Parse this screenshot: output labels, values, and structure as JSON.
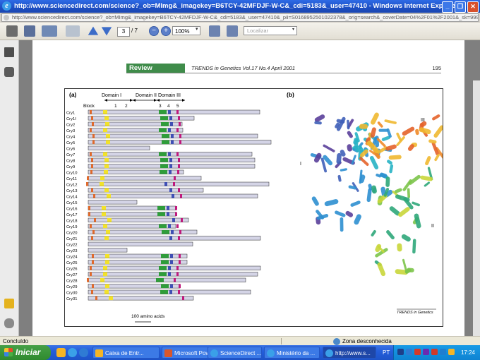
{
  "window": {
    "title": "http://www.sciencedirect.com/science?_ob=MImg&_imagekey=B6TCY-42MFDJF-W-C&_cdi=5183&_user=47410 - Windows Internet Explorer",
    "url": "http://www.sciencedirect.com/science?_ob=MImg&_imagekey=B6TCY-42MFDJF-W-C&_cdi=5183&_user=47410&_pii=S0168952501022378&_orig=search&_coverDate=04%2F01%2F2001&_sk=999829"
  },
  "toolbar": {
    "page_current": "3",
    "page_total": "/ 7",
    "zoom": "100%",
    "search_placeholder": "Localizar"
  },
  "document": {
    "header_tag": "Review",
    "journal": "TRENDS in Genetics  Vol.17 No.4  April 2001",
    "page_number": "195",
    "figure": {
      "panel_a": "(a)",
      "panel_b": "(b)",
      "domain_1": "Domain I",
      "domain_2": "Domain II",
      "domain_3": "Domain III",
      "block_label": "Block",
      "block_numbers": [
        "1",
        "2",
        "3",
        "4",
        "5"
      ],
      "scale_label": "100 amino acids",
      "proteins": [
        "Cry1",
        "Cry1I",
        "Cry2",
        "Cry3",
        "Cry4",
        "Cry5",
        "Cry6",
        "Cry7",
        "Cry8",
        "Cry9",
        "Cry10",
        "Cry11",
        "Cry12",
        "Cry13",
        "Cry14",
        "Cry15",
        "Cry16",
        "Cry17",
        "Cry18",
        "Cry19",
        "Cry20",
        "Cry21",
        "Cry22",
        "Cry23",
        "Cry24",
        "Cry25",
        "Cry26",
        "Cry27",
        "Cry28",
        "Cry29",
        "Cry30",
        "Cry31"
      ],
      "structure_labels": {
        "domain_1": "I",
        "domain_2": "II",
        "domain_3": "III"
      },
      "credit": "TRENDS in Genetics"
    }
  },
  "status": {
    "left": "Concluído",
    "zone": "Zona desconhecida"
  },
  "taskbar": {
    "start": "Iniciar",
    "tasks": [
      "Caixa de Entr...",
      "Microsoft Pow...",
      "ScienceDirect ...",
      "Ministério da ...",
      "http://www.s..."
    ],
    "language": "PT",
    "time": "17:24"
  },
  "colors": {
    "block1": "#e06a2c",
    "block2": "#f2e22a",
    "block3": "#2f9d3a",
    "block4": "#3f4fb5",
    "block5": "#c0187c",
    "bar": "#d4d4e6",
    "review_green": "#3f8c4a"
  }
}
